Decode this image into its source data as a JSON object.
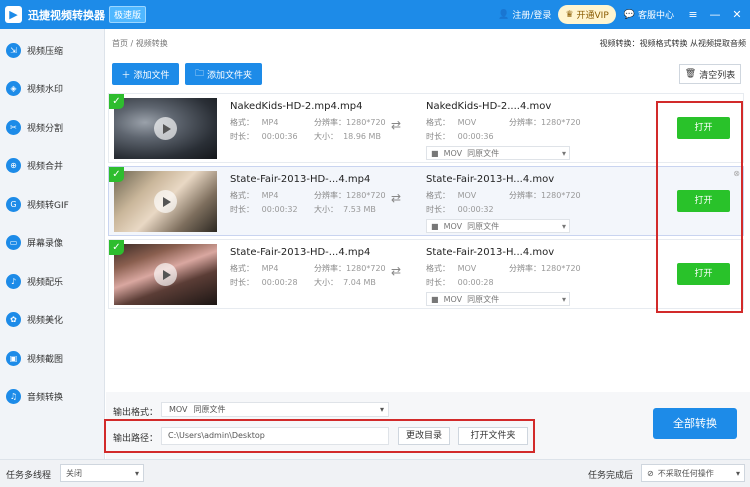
{
  "app": {
    "title": "迅捷视频转换器",
    "edition": "极速版",
    "login": "注册/登录",
    "vip": "开通VIP",
    "help": "客服中心",
    "win_buttons": [
      "≡",
      "—",
      "✕"
    ]
  },
  "sidebar": {
    "items": [
      {
        "label": "视频压缩",
        "icon": "compress-icon"
      },
      {
        "label": "视频水印",
        "icon": "watermark-icon"
      },
      {
        "label": "视频分割",
        "icon": "split-icon"
      },
      {
        "label": "视频合并",
        "icon": "merge-icon"
      },
      {
        "label": "视频转GIF",
        "icon": "gif-icon"
      },
      {
        "label": "屏幕录像",
        "icon": "screen-record-icon"
      },
      {
        "label": "视频配乐",
        "icon": "music-icon"
      },
      {
        "label": "视频美化",
        "icon": "beautify-icon"
      },
      {
        "label": "视频截图",
        "icon": "screenshot-icon"
      },
      {
        "label": "音频转换",
        "icon": "audio-icon"
      }
    ]
  },
  "breadcrumb": {
    "home": "首页",
    "sep": "/",
    "current": "视频转换"
  },
  "tip": "视频转换：视频格式转换 从视频提取音频",
  "toolbar": {
    "add_file": "添加文件",
    "add_folder": "添加文件夹",
    "clear": "清空列表"
  },
  "labels": {
    "format": "格式：",
    "resolution": "分辨率：",
    "duration": "时长：",
    "size": "大小：",
    "open": "打开",
    "same_as_source": "同原文件"
  },
  "files": [
    {
      "src_name": "NakedKids-HD-2.mp4.mp4",
      "src_format": "MP4",
      "src_res": "1280*720",
      "src_duration": "00:00:36",
      "src_size": "18.96 MB",
      "dst_name": "NakedKids-HD-2....4.mov",
      "dst_format": "MOV",
      "dst_res": "1280*720",
      "dst_duration": "00:00:36",
      "dst_opt": "MOV"
    },
    {
      "src_name": "State-Fair-2013-HD-...4.mp4",
      "src_format": "MP4",
      "src_res": "1280*720",
      "src_duration": "00:00:32",
      "src_size": "7.53 MB",
      "dst_name": "State-Fair-2013-H...4.mov",
      "dst_format": "MOV",
      "dst_res": "1280*720",
      "dst_duration": "00:00:32",
      "dst_opt": "MOV"
    },
    {
      "src_name": "State-Fair-2013-HD-...4.mp4",
      "src_format": "MP4",
      "src_res": "1280*720",
      "src_duration": "00:00:28",
      "src_size": "7.04 MB",
      "dst_name": "State-Fair-2013-H...4.mov",
      "dst_format": "MOV",
      "dst_res": "1280*720",
      "dst_duration": "00:00:28",
      "dst_opt": "MOV"
    }
  ],
  "output": {
    "format_label": "输出格式：",
    "format_value": "MOV",
    "format_note": "同原文件",
    "path_label": "输出路径：",
    "path": "C:\\Users\\admin\\Desktop",
    "change_dir": "更改目录",
    "open_folder": "打开文件夹",
    "convert_all": "全部转换"
  },
  "status": {
    "multithread_label": "任务多线程",
    "multithread_value": "关闭",
    "after_label": "任务完成后",
    "after_value": "不采取任何操作"
  },
  "colors": {
    "brand": "#1d8be8",
    "open_button": "#29c22a",
    "highlight": "#d22a2a"
  }
}
